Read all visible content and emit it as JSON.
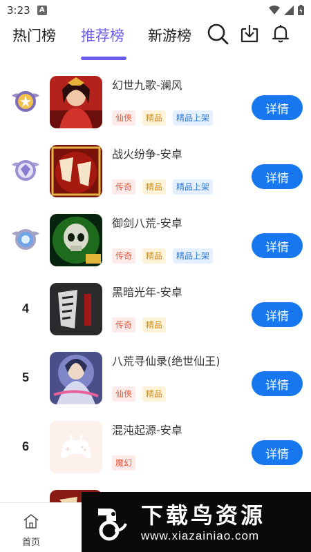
{
  "status": {
    "time": "3:23",
    "notify_badge": "A"
  },
  "tabs": [
    {
      "label": "热门榜",
      "active": false
    },
    {
      "label": "推荐榜",
      "active": true
    },
    {
      "label": "新游榜",
      "active": false
    }
  ],
  "header_icons": [
    "search-icon",
    "download-icon",
    "bell-icon"
  ],
  "games": [
    {
      "rank": "",
      "medal": "gold-medal-icon",
      "title": "幻世九歌-澜风",
      "tags": [
        "仙侠",
        "精品",
        "精品上架"
      ],
      "button": "详情"
    },
    {
      "rank": "",
      "medal": "silver-medal-icon",
      "title": "战火纷争-安卓",
      "tags": [
        "传奇",
        "精品",
        "精品上架"
      ],
      "button": "详情"
    },
    {
      "rank": "",
      "medal": "bronze-medal-icon",
      "title": "御剑八荒-安卓",
      "tags": [
        "传奇",
        "精品",
        "精品上架"
      ],
      "button": "详情"
    },
    {
      "rank": "4",
      "medal": "",
      "title": "黑暗光年-安卓",
      "tags": [
        "传奇",
        "精品"
      ],
      "button": "详情"
    },
    {
      "rank": "5",
      "medal": "",
      "title": "八荒寻仙录(绝世仙王)",
      "tags": [
        "仙侠",
        "精品"
      ],
      "button": "详情"
    },
    {
      "rank": "6",
      "medal": "",
      "title": "混沌起源-安卓",
      "tags": [
        "魔幻"
      ],
      "button": "详情"
    }
  ],
  "bottom_nav": {
    "home_label": "首页"
  },
  "watermark": {
    "title": "下载鸟资源",
    "url": "www.xiazainiao.com"
  },
  "colors": {
    "accent": "#6b5cf0",
    "button": "#1677ee"
  }
}
